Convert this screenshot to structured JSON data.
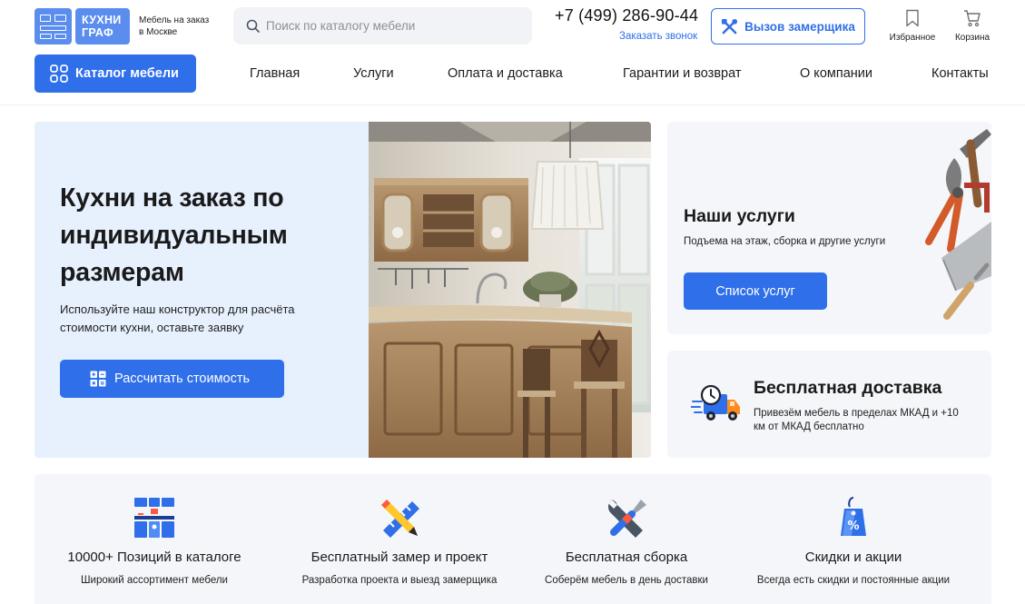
{
  "header": {
    "logo": {
      "line1": "КУХНИ",
      "line2": "ГРАФ",
      "tagline": "Мебель на заказ в Москве"
    },
    "search": {
      "placeholder": "Поиск по каталогу мебели",
      "icon": "search-icon"
    },
    "phone": "+7 (499) 286-90-44",
    "callback_label": "Заказать звонок",
    "measure_button": "Вызов замерщика",
    "favorites_label": "Избранное",
    "cart_label": "Корзина"
  },
  "nav": {
    "catalog_button": "Каталог мебели",
    "items": [
      {
        "label": "Главная"
      },
      {
        "label": "Услуги"
      },
      {
        "label": "Оплата и доставка"
      },
      {
        "label": "Гарантии и возврат"
      },
      {
        "label": "О компании"
      },
      {
        "label": "Контакты"
      }
    ]
  },
  "hero": {
    "title": "Кухни на заказ по индивидуальным размерам",
    "subtitle": "Используйте наш конструктор для расчёта стоимости кухни, оставьте заявку",
    "button": "Рассчитать стоимость"
  },
  "services_card": {
    "title": "Наши услуги",
    "subtitle": "Подъема на этаж, сборка и другие услуги",
    "button": "Список услуг"
  },
  "delivery_card": {
    "title": "Бесплатная доставка",
    "subtitle": "Привезём мебель в пределах МКАД и +10 км от МКАД бесплатно"
  },
  "features": [
    {
      "title": "10000+ Позиций в каталоге",
      "desc": "Широкий ассортимент мебели",
      "icon": "kitchen-icon"
    },
    {
      "title": "Бесплатный замер и проект",
      "desc": "Разработка проекта и выезд замерщика",
      "icon": "pencil-ruler-icon"
    },
    {
      "title": "Бесплатная сборка",
      "desc": "Соберём мебель в день доставки",
      "icon": "wrench-screwdriver-icon"
    },
    {
      "title": "Скидки и акции",
      "desc": "Всегда есть скидки и постоянные акции",
      "icon": "discount-tag-icon"
    }
  ],
  "colors": {
    "accent": "#2f6fe9",
    "logo": "#5b8def",
    "hero_bg": "#e7f0fd",
    "card_bg": "#f4f6f9"
  }
}
